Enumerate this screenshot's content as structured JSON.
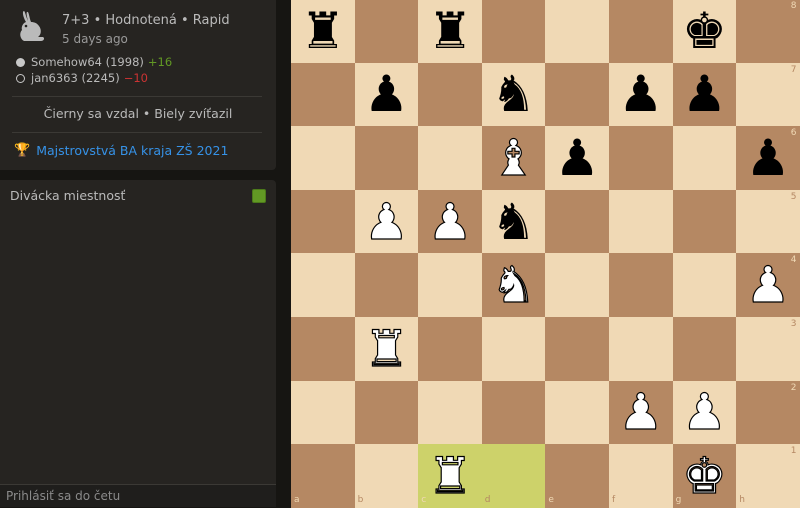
{
  "game": {
    "setup": "7+3 • Hodnotená • Rapid",
    "date": "5 days ago",
    "players": [
      {
        "color": "white",
        "name": "Somehow64 (1998)",
        "diff": "+16"
      },
      {
        "color": "black",
        "name": "jan6363 (2245)",
        "diff": "−10"
      }
    ],
    "result": "Čierny sa vzdal • Biely zvíťazil",
    "tournament": "Majstrovstvá BA kraja ZŠ 2021"
  },
  "icons": {
    "variant": "rabbit-icon",
    "tournament": "trophy-icon"
  },
  "chat": {
    "title": "Divácka miestnosť",
    "toggle_on": true,
    "placeholder": "Prihlásiť sa do četu"
  },
  "board": {
    "files": [
      "a",
      "b",
      "c",
      "d",
      "e",
      "f",
      "g",
      "h"
    ],
    "ranks": [
      "8",
      "7",
      "6",
      "5",
      "4",
      "3",
      "2",
      "1"
    ],
    "highlight": [
      "c1",
      "d1"
    ],
    "pieces": [
      {
        "sq": "a8",
        "p": "bR"
      },
      {
        "sq": "c8",
        "p": "bR"
      },
      {
        "sq": "g8",
        "p": "bK"
      },
      {
        "sq": "b7",
        "p": "bP"
      },
      {
        "sq": "d7",
        "p": "bN"
      },
      {
        "sq": "f7",
        "p": "bP"
      },
      {
        "sq": "g7",
        "p": "bP"
      },
      {
        "sq": "d6",
        "p": "wB"
      },
      {
        "sq": "e6",
        "p": "bP"
      },
      {
        "sq": "h6",
        "p": "bP"
      },
      {
        "sq": "b5",
        "p": "wP"
      },
      {
        "sq": "c5",
        "p": "wP"
      },
      {
        "sq": "d5",
        "p": "bN"
      },
      {
        "sq": "d4",
        "p": "wN"
      },
      {
        "sq": "h4",
        "p": "wP"
      },
      {
        "sq": "b3",
        "p": "wR"
      },
      {
        "sq": "f2",
        "p": "wP"
      },
      {
        "sq": "g2",
        "p": "wP"
      },
      {
        "sq": "c1",
        "p": "wR"
      },
      {
        "sq": "g1",
        "p": "wK"
      }
    ]
  },
  "colors": {
    "light": "#f0d9b5",
    "dark": "#b58863",
    "highlight": "#cdd26a",
    "link": "#3692e7",
    "positive": "#629924",
    "negative": "#cc3333"
  }
}
